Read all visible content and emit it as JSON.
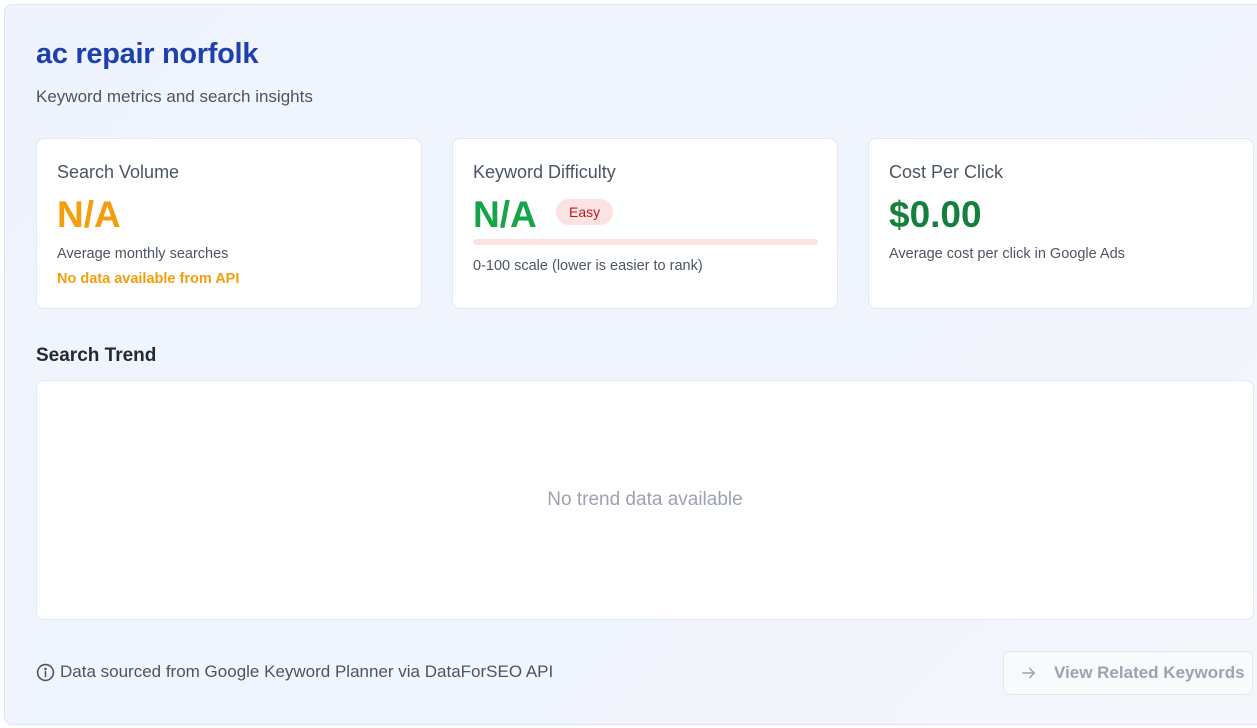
{
  "header": {
    "keyword": "ac repair norfolk",
    "subtitle": "Keyword metrics and search insights"
  },
  "cards": {
    "search_volume": {
      "label": "Search Volume",
      "value": "N/A",
      "description": "Average monthly searches",
      "note": "No data available from API",
      "value_color": "#f59e0b"
    },
    "keyword_difficulty": {
      "label": "Keyword Difficulty",
      "value": "N/A",
      "badge": "Easy",
      "progress_fraction": 0,
      "description": "0-100 scale (lower is easier to rank)",
      "value_color": "#16a34a"
    },
    "cost_per_click": {
      "label": "Cost Per Click",
      "value": "$0.00",
      "description": "Average cost per click in Google Ads",
      "value_color": "#15803d"
    }
  },
  "trend": {
    "title": "Search Trend",
    "empty_message": "No trend data available"
  },
  "footer": {
    "source_note": "Data sourced from Google Keyword Planner via DataForSEO API",
    "info_icon": "info-circle-icon",
    "related_button_label": "View Related Keywords",
    "related_button_icon": "arrow-right-icon"
  },
  "colors": {
    "accent": "#1e40af",
    "warning": "#f59e0b",
    "success": "#16a34a",
    "badge_bg": "#fde2e2",
    "badge_text": "#b91c1c"
  }
}
